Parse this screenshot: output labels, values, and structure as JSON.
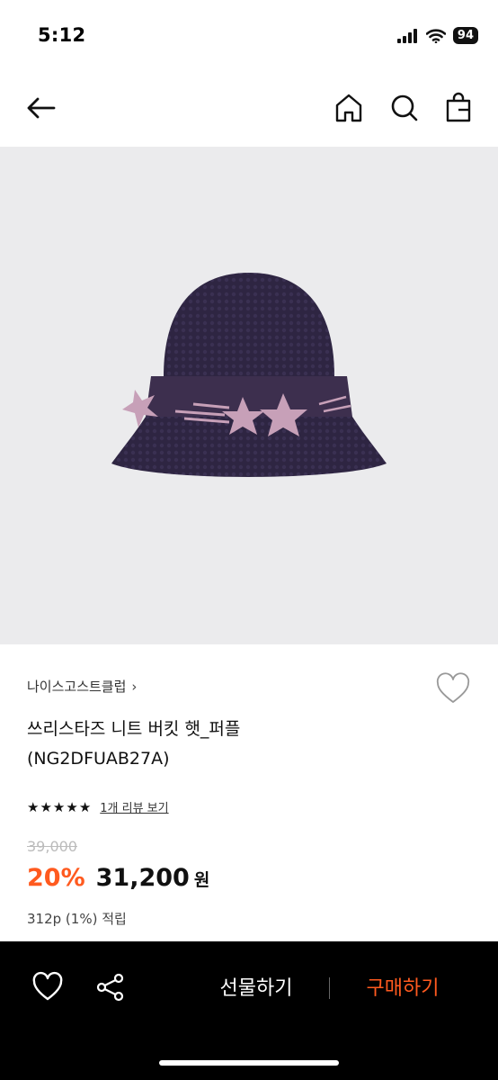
{
  "status_bar": {
    "time": "5:12",
    "battery": "94",
    "icons": [
      "signal-icon",
      "wifi-icon",
      "battery-icon"
    ]
  },
  "nav": {
    "icons": [
      "back-arrow-icon",
      "home-icon",
      "search-icon",
      "shopping-bag-icon"
    ]
  },
  "product": {
    "brand": "나이스고스트클럽",
    "title_line1": "쓰리스타즈 니트 버킷 햇_퍼플",
    "title_line2": "(NG2DFUAB27A)",
    "image_icon": "purple-knit-bucket-hat-image",
    "rating": 5,
    "review_link": "1개 리뷰 보기",
    "original_price": "39,000",
    "discount": "20%",
    "sale_price": "31,200",
    "currency": "원",
    "points": "312p (1%) 적립"
  },
  "bottom_bar": {
    "gift_label": "선물하기",
    "buy_label": "구매하기",
    "icons": [
      "heart-icon",
      "share-icon"
    ]
  },
  "colors": {
    "accent": "#ff5a1f",
    "image_bg": "#ebebed",
    "bottom_bar_bg": "#000000"
  }
}
